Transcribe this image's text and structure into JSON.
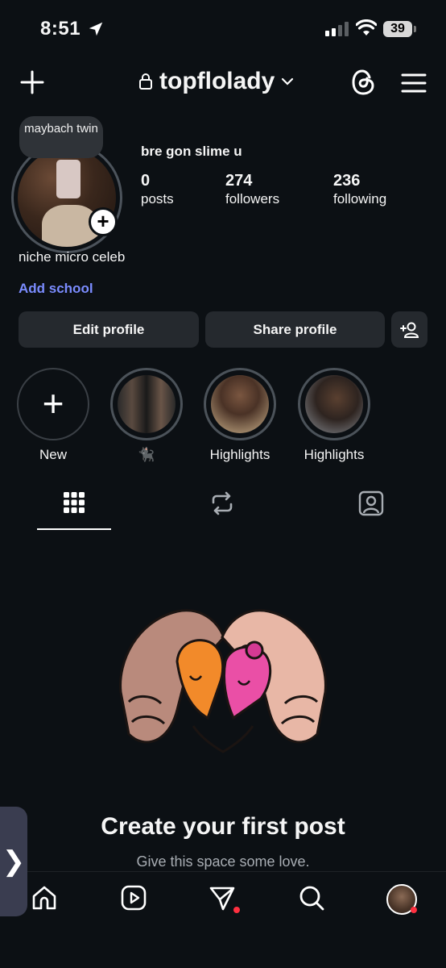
{
  "status_bar": {
    "time": "8:51",
    "battery": "39"
  },
  "header": {
    "username": "topflolady"
  },
  "profile": {
    "note": "maybach twin",
    "display_name": "bre gon slime u",
    "stats": [
      {
        "value": "0",
        "label": "posts"
      },
      {
        "value": "274",
        "label": "followers"
      },
      {
        "value": "236",
        "label": "following"
      }
    ],
    "bio": "niche micro celeb",
    "add_school": "Add school"
  },
  "buttons": {
    "edit": "Edit profile",
    "share": "Share profile"
  },
  "highlights": [
    {
      "label": "New"
    },
    {
      "label": "🐈‍⬛"
    },
    {
      "label": "Highlights"
    },
    {
      "label": "Highlights"
    }
  ],
  "empty_state": {
    "title": "Create your first post",
    "subtitle": "Give this space some love."
  },
  "side_handle": "❯",
  "colors": {
    "background": "#0c1014",
    "link": "#7b8cff",
    "button": "#25292e",
    "notification": "#ff3040"
  }
}
